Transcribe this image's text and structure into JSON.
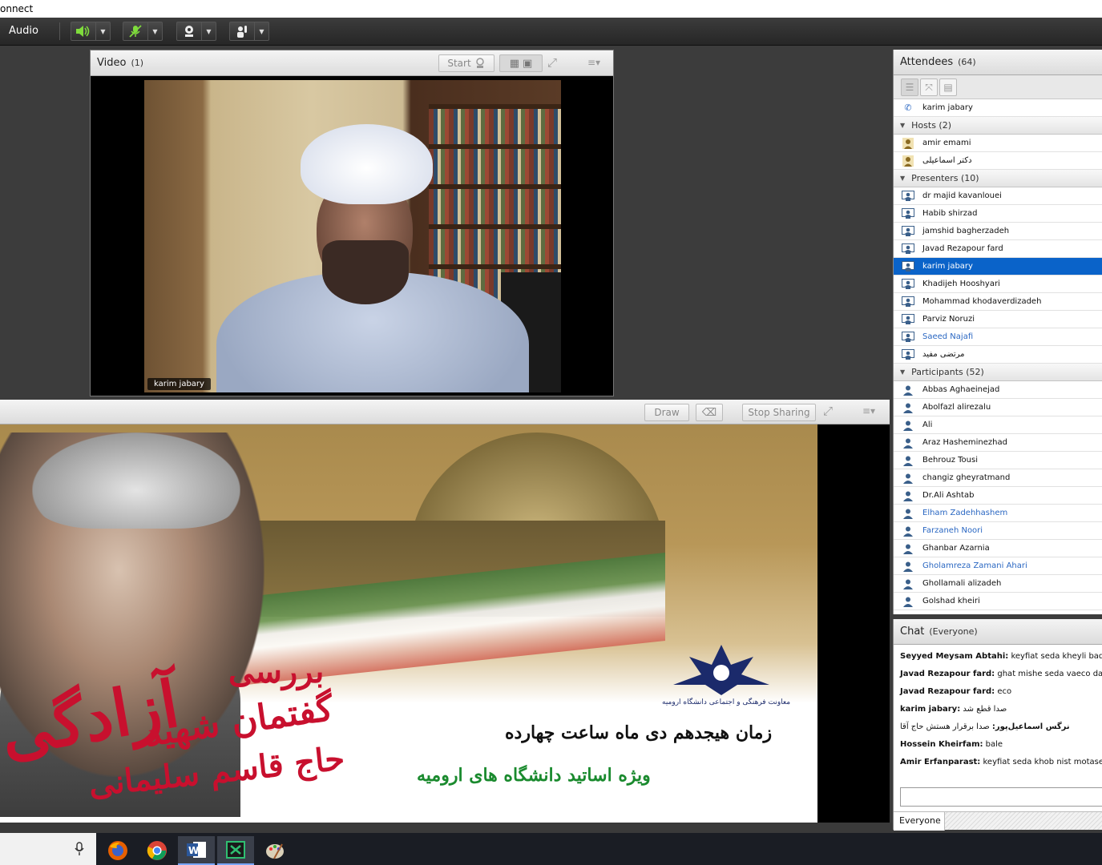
{
  "titlebar": {
    "title": "onnect"
  },
  "toolbar": {
    "audio_label": "Audio"
  },
  "video_pod": {
    "title": "Video",
    "count": "(1)",
    "start_label": "Start",
    "name_tag": "karim jabary"
  },
  "share_pod": {
    "draw_label": "Draw",
    "stop_sharing_label": "Stop Sharing"
  },
  "slide": {
    "title_line1": "بررسی",
    "title_line2": "گفتمان شهید",
    "title_line3": "حاج قاسم سلیمانی",
    "big_word": "آزادگی",
    "time_line": "زمان هیجدهم دی ماه ساعت چهارده",
    "special_line": "ویژه اساتید دانشگاه های ارومیه",
    "org_name": "معاونت فرهنگی و اجتماعی دانشگاه ارومیه"
  },
  "attendees": {
    "title": "Attendees",
    "count": "(64)",
    "me": "karim jabary",
    "hosts_label": "Hosts (2)",
    "hosts": [
      {
        "name": "amir emami"
      },
      {
        "name": "دکتر اسماعیلی"
      }
    ],
    "presenters_label": "Presenters (10)",
    "presenters": [
      {
        "name": "dr majid kavanlouei"
      },
      {
        "name": "Habib shirzad"
      },
      {
        "name": "jamshid bagherzadeh"
      },
      {
        "name": "Javad Rezapour fard"
      },
      {
        "name": "karim jabary"
      },
      {
        "name": "Khadijeh Hooshyari"
      },
      {
        "name": "Mohammad khodaverdizadeh"
      },
      {
        "name": "Parviz Noruzi"
      },
      {
        "name": "Saeed Najafi"
      },
      {
        "name": "مرتضی مفید"
      }
    ],
    "participants_label": "Participants (52)",
    "participants": [
      {
        "name": "Abbas Aghaeinejad"
      },
      {
        "name": "Abolfazl alirezalu"
      },
      {
        "name": "Ali"
      },
      {
        "name": "Araz Hasheminezhad"
      },
      {
        "name": "Behrouz Tousi"
      },
      {
        "name": "changiz gheyratmand"
      },
      {
        "name": "Dr.Ali Ashtab"
      },
      {
        "name": "Elham Zadehhashem"
      },
      {
        "name": "Farzaneh Noori"
      },
      {
        "name": "Ghanbar Azarnia"
      },
      {
        "name": "Gholamreza Zamani Ahari"
      },
      {
        "name": "Ghollamali alizadeh"
      },
      {
        "name": "Golshad kheiri"
      }
    ]
  },
  "chat": {
    "title": "Chat",
    "scope": "(Everyone)",
    "messages": [
      {
        "sender": "Seyyed Meysam Abtahi:",
        "text": "keyfiat seda kheyli bade"
      },
      {
        "sender": "Javad Rezapour fard:",
        "text": "ghat mishe seda vaeco dare"
      },
      {
        "sender": "Javad Rezapour fard:",
        "text": "eco"
      },
      {
        "sender": "karim jabary:",
        "text": "صدا قطع شد"
      },
      {
        "sender": "نرگس اسماعیل‌پور:",
        "text": "صدا برقرار هستش حاج آقا"
      },
      {
        "sender": "Hossein Kheirfam:",
        "text": "bale"
      },
      {
        "sender": "Amir Erfanparast:",
        "text": "keyfiat seda khob nist motasefane"
      }
    ],
    "target_label": "Everyone"
  },
  "colors": {
    "selected_row": "#0a63c9",
    "link_name": "#2a67c2",
    "slide_red": "#c8102e",
    "slide_green": "#1a8a2e"
  }
}
